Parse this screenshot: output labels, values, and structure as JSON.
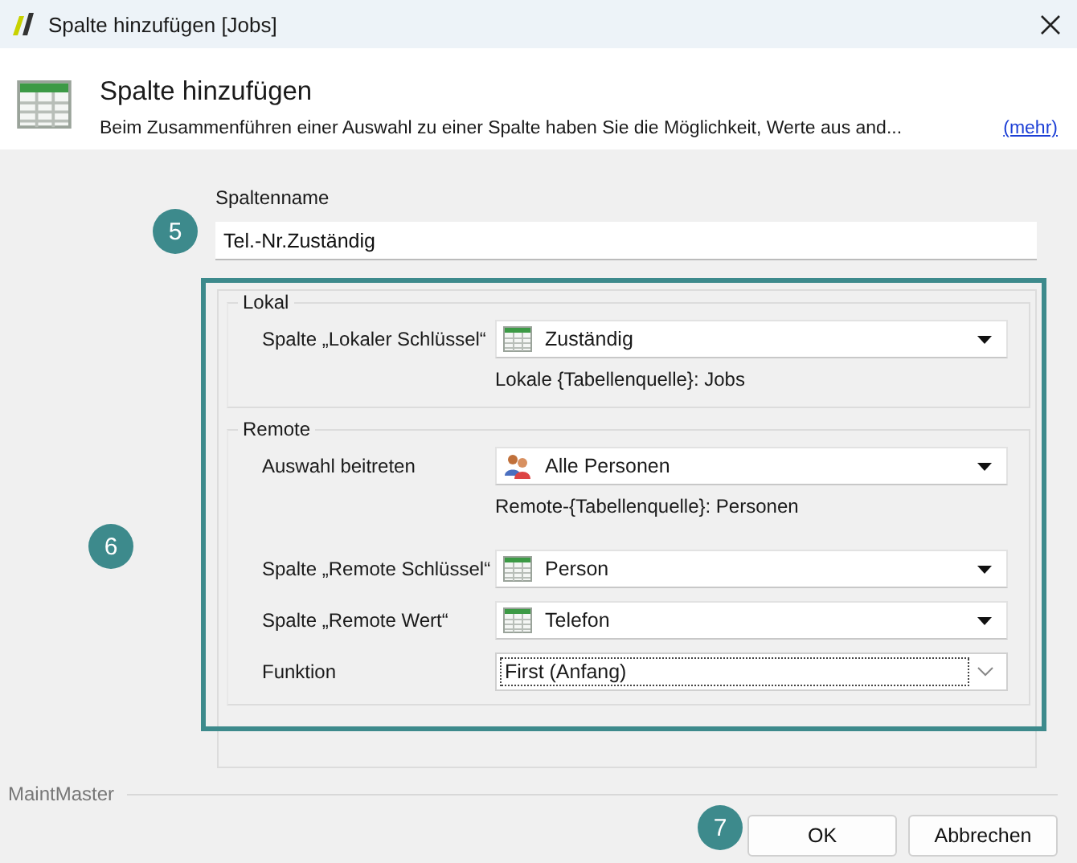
{
  "window": {
    "title": "Spalte hinzufügen [Jobs]"
  },
  "header": {
    "title": "Spalte hinzufügen",
    "description": "Beim Zusammenführen einer Auswahl zu einer Spalte haben Sie die Möglichkeit, Werte aus and...",
    "more_link": "(mehr)"
  },
  "column_name": {
    "label": "Spaltenname",
    "value": "Tel.-Nr.Zuständig"
  },
  "groups": [
    {
      "title": "Lokal",
      "rows": [
        {
          "kind": "table",
          "label": "Spalte „Lokaler Schlüssel“",
          "value": "Zuständig",
          "note": "Lokale {Tabellenquelle}: Jobs",
          "focused": false
        }
      ]
    },
    {
      "title": "Remote",
      "rows": [
        {
          "kind": "people",
          "label": "Auswahl beitreten",
          "value": "Alle Personen",
          "note": "Remote-{Tabellenquelle}: Personen",
          "focused": false
        },
        {
          "kind": "table",
          "label": "Spalte „Remote Schlüssel“",
          "value": "Person",
          "focused": false
        },
        {
          "kind": "table",
          "label": "Spalte „Remote Wert“",
          "value": "Telefon",
          "focused": false
        },
        {
          "kind": "plain",
          "label": "Funktion",
          "value": "First (Anfang)",
          "focused": true
        }
      ]
    }
  ],
  "footer": {
    "brand": "MaintMaster"
  },
  "buttons": [
    {
      "label": "OK"
    },
    {
      "label": "Abbrechen"
    }
  ],
  "callouts": [
    "5",
    "6",
    "7"
  ]
}
